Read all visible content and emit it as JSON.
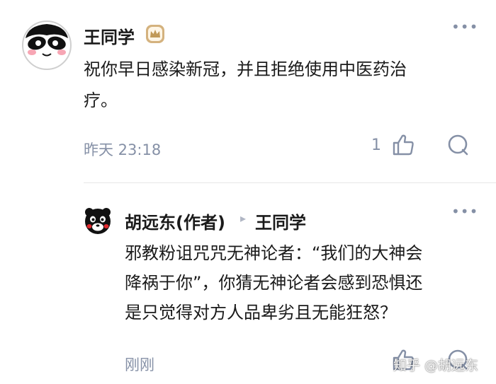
{
  "comment1": {
    "author": "王同学",
    "badge_icon": "crown-badge-icon",
    "text_line1": "祝你早日感染新冠，并且拒绝使用中医药治",
    "text_line2": "疗。",
    "time": "昨天 23:18",
    "like_count": "1",
    "more_label": "•••"
  },
  "reply1": {
    "author": "胡远东(作者)",
    "reply_arrow": "▸",
    "reply_to": "王同学",
    "text_line1": "邪教粉诅咒咒无神论者：“我们的大神会",
    "text_line2": "降祸于你”，你猜无神论者会感到恐惧还",
    "text_line3": "是只觉得对方人品卑劣且无能狂怒？",
    "time": "刚刚",
    "more_label": "•••"
  },
  "watermark": "知乎 @胡远东",
  "colors": {
    "meta": "#8590a6",
    "badge": "#c9a46a",
    "text": "#1a1a1a"
  }
}
